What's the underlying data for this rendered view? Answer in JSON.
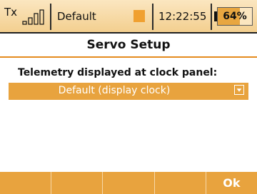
{
  "status": {
    "tx_label": "Tx",
    "profile": "Default",
    "indicator_color": "#f0a030",
    "time": "12:22:55",
    "battery_text": "64%",
    "battery_level": 0.64
  },
  "page": {
    "title": "Servo Setup"
  },
  "form": {
    "label": "Telemetry displayed at clock panel:",
    "selected_value": "Default (display clock)"
  },
  "softkeys": [
    "",
    "",
    "",
    "",
    "Ok"
  ],
  "colors": {
    "accent": "#e8a33e",
    "statusbar": "#f3cf8f",
    "title_rule": "#e58b1e"
  }
}
